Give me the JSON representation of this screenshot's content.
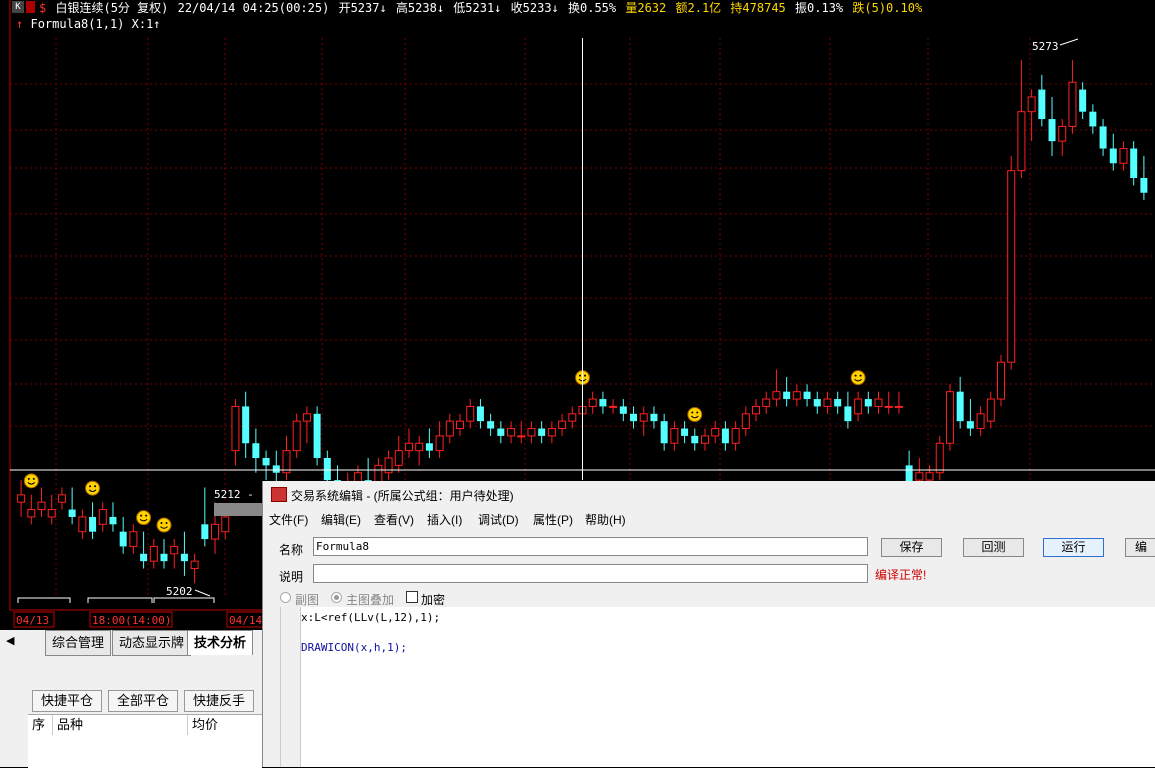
{
  "header": {
    "k_button": "K",
    "symbol_marker": "$",
    "instrument": "白银连续(5分 复权)",
    "datetime": "22/04/14 04:25(00:25)",
    "open": "开5237↓",
    "high": "高5238↓",
    "low": "低5231↓",
    "close": "收5233↓",
    "turnover": "换0.55%",
    "volume": "量2632",
    "amount": "额2.1亿",
    "hold": "持478745",
    "amplitude": "振0.13%",
    "change": "跌(5)0.10%"
  },
  "formula_line": {
    "arrow": "↑",
    "text": "Formula8(1,1) X:1↑"
  },
  "chart": {
    "price_high_label": "5273",
    "price_low_label": "5202",
    "cursor_label": "5212 -",
    "time_labels": [
      "04/13",
      "18:00(14:00)",
      "04/14"
    ],
    "colors": {
      "up": "#ff2020",
      "down": "#54ffff",
      "grid": "#7a0000",
      "axis": "#c00000",
      "smiley": "#ffd200"
    }
  },
  "chart_data": {
    "type": "candlestick",
    "series": [
      {
        "o": 5213,
        "h": 5216,
        "l": 5211,
        "c": 5214
      },
      {
        "o": 5211,
        "h": 5214,
        "l": 5210,
        "c": 5212
      },
      {
        "o": 5212,
        "h": 5215,
        "l": 5211,
        "c": 5213
      },
      {
        "o": 5211,
        "h": 5214,
        "l": 5210,
        "c": 5212
      },
      {
        "o": 5213,
        "h": 5215,
        "l": 5212,
        "c": 5214
      },
      {
        "o": 5212,
        "h": 5215,
        "l": 5210,
        "c": 5211
      },
      {
        "o": 5209,
        "h": 5212,
        "l": 5208,
        "c": 5211
      },
      {
        "o": 5211,
        "h": 5213,
        "l": 5208,
        "c": 5209
      },
      {
        "o": 5210,
        "h": 5213,
        "l": 5209,
        "c": 5212
      },
      {
        "o": 5211,
        "h": 5213,
        "l": 5209,
        "c": 5210
      },
      {
        "o": 5209,
        "h": 5211,
        "l": 5206,
        "c": 5207
      },
      {
        "o": 5207,
        "h": 5210,
        "l": 5206,
        "c": 5209
      },
      {
        "o": 5206,
        "h": 5209,
        "l": 5204,
        "c": 5205
      },
      {
        "o": 5205,
        "h": 5208,
        "l": 5204,
        "c": 5207
      },
      {
        "o": 5206,
        "h": 5208,
        "l": 5204,
        "c": 5205
      },
      {
        "o": 5206,
        "h": 5208,
        "l": 5204,
        "c": 5207
      },
      {
        "o": 5206,
        "h": 5209,
        "l": 5203,
        "c": 5205
      },
      {
        "o": 5204,
        "h": 5206,
        "l": 5202,
        "c": 5205
      },
      {
        "o": 5210,
        "h": 5215,
        "l": 5207,
        "c": 5208
      },
      {
        "o": 5208,
        "h": 5213,
        "l": 5206,
        "c": 5210
      },
      {
        "o": 5209,
        "h": 5212,
        "l": 5208,
        "c": 5211
      },
      {
        "o": 5220,
        "h": 5227,
        "l": 5218,
        "c": 5226
      },
      {
        "o": 5226,
        "h": 5228,
        "l": 5219,
        "c": 5221
      },
      {
        "o": 5221,
        "h": 5223,
        "l": 5217,
        "c": 5219
      },
      {
        "o": 5219,
        "h": 5220,
        "l": 5216,
        "c": 5218
      },
      {
        "o": 5218,
        "h": 5220,
        "l": 5214,
        "c": 5217
      },
      {
        "o": 5217,
        "h": 5222,
        "l": 5216,
        "c": 5220
      },
      {
        "o": 5220,
        "h": 5225,
        "l": 5219,
        "c": 5224
      },
      {
        "o": 5224,
        "h": 5226,
        "l": 5221,
        "c": 5225
      },
      {
        "o": 5225,
        "h": 5226,
        "l": 5218,
        "c": 5219
      },
      {
        "o": 5219,
        "h": 5220,
        "l": 5215,
        "c": 5216
      },
      {
        "o": 5216,
        "h": 5218,
        "l": 5213,
        "c": 5214
      },
      {
        "o": 5214,
        "h": 5217,
        "l": 5213,
        "c": 5215
      },
      {
        "o": 5215,
        "h": 5218,
        "l": 5214,
        "c": 5217
      },
      {
        "o": 5216,
        "h": 5219,
        "l": 5214,
        "c": 5215
      },
      {
        "o": 5215,
        "h": 5219,
        "l": 5214,
        "c": 5218
      },
      {
        "o": 5217,
        "h": 5220,
        "l": 5216,
        "c": 5219
      },
      {
        "o": 5218,
        "h": 5222,
        "l": 5217,
        "c": 5220
      },
      {
        "o": 5220,
        "h": 5223,
        "l": 5219,
        "c": 5221
      },
      {
        "o": 5220,
        "h": 5222,
        "l": 5218,
        "c": 5221
      },
      {
        "o": 5221,
        "h": 5223,
        "l": 5219,
        "c": 5220
      },
      {
        "o": 5220,
        "h": 5224,
        "l": 5219,
        "c": 5222
      },
      {
        "o": 5222,
        "h": 5225,
        "l": 5221,
        "c": 5224
      },
      {
        "o": 5223,
        "h": 5225,
        "l": 5222,
        "c": 5224
      },
      {
        "o": 5224,
        "h": 5227,
        "l": 5223,
        "c": 5226
      },
      {
        "o": 5226,
        "h": 5227,
        "l": 5223,
        "c": 5224
      },
      {
        "o": 5224,
        "h": 5225,
        "l": 5222,
        "c": 5223
      },
      {
        "o": 5223,
        "h": 5224,
        "l": 5221,
        "c": 5222
      },
      {
        "o": 5222,
        "h": 5224,
        "l": 5221,
        "c": 5223
      },
      {
        "o": 5222,
        "h": 5224,
        "l": 5221,
        "c": 5222
      },
      {
        "o": 5222,
        "h": 5224,
        "l": 5221,
        "c": 5223
      },
      {
        "o": 5223,
        "h": 5224,
        "l": 5221,
        "c": 5222
      },
      {
        "o": 5222,
        "h": 5224,
        "l": 5221,
        "c": 5223
      },
      {
        "o": 5223,
        "h": 5225,
        "l": 5222,
        "c": 5224
      },
      {
        "o": 5224,
        "h": 5226,
        "l": 5223,
        "c": 5225
      },
      {
        "o": 5225,
        "h": 5228,
        "l": 5224,
        "c": 5226
      },
      {
        "o": 5226,
        "h": 5228,
        "l": 5225,
        "c": 5227
      },
      {
        "o": 5227,
        "h": 5228,
        "l": 5225,
        "c": 5226
      },
      {
        "o": 5226,
        "h": 5227,
        "l": 5225,
        "c": 5226
      },
      {
        "o": 5226,
        "h": 5227,
        "l": 5224,
        "c": 5225
      },
      {
        "o": 5225,
        "h": 5226,
        "l": 5223,
        "c": 5224
      },
      {
        "o": 5224,
        "h": 5226,
        "l": 5222,
        "c": 5225
      },
      {
        "o": 5225,
        "h": 5226,
        "l": 5223,
        "c": 5224
      },
      {
        "o": 5224,
        "h": 5225,
        "l": 5220,
        "c": 5221
      },
      {
        "o": 5221,
        "h": 5224,
        "l": 5220,
        "c": 5223
      },
      {
        "o": 5223,
        "h": 5224,
        "l": 5221,
        "c": 5222
      },
      {
        "o": 5222,
        "h": 5223,
        "l": 5220,
        "c": 5221
      },
      {
        "o": 5221,
        "h": 5223,
        "l": 5220,
        "c": 5222
      },
      {
        "o": 5222,
        "h": 5224,
        "l": 5221,
        "c": 5223
      },
      {
        "o": 5223,
        "h": 5224,
        "l": 5220,
        "c": 5221
      },
      {
        "o": 5221,
        "h": 5224,
        "l": 5220,
        "c": 5223
      },
      {
        "o": 5223,
        "h": 5226,
        "l": 5222,
        "c": 5225
      },
      {
        "o": 5225,
        "h": 5227,
        "l": 5224,
        "c": 5226
      },
      {
        "o": 5226,
        "h": 5228,
        "l": 5225,
        "c": 5227
      },
      {
        "o": 5227,
        "h": 5231,
        "l": 5226,
        "c": 5228
      },
      {
        "o": 5228,
        "h": 5230,
        "l": 5226,
        "c": 5227
      },
      {
        "o": 5227,
        "h": 5229,
        "l": 5226,
        "c": 5228
      },
      {
        "o": 5228,
        "h": 5229,
        "l": 5226,
        "c": 5227
      },
      {
        "o": 5227,
        "h": 5228,
        "l": 5225,
        "c": 5226
      },
      {
        "o": 5226,
        "h": 5228,
        "l": 5225,
        "c": 5227
      },
      {
        "o": 5227,
        "h": 5228,
        "l": 5225,
        "c": 5226
      },
      {
        "o": 5226,
        "h": 5228,
        "l": 5223,
        "c": 5224
      },
      {
        "o": 5225,
        "h": 5228,
        "l": 5224,
        "c": 5227
      },
      {
        "o": 5227,
        "h": 5228,
        "l": 5225,
        "c": 5226
      },
      {
        "o": 5226,
        "h": 5228,
        "l": 5225,
        "c": 5227
      },
      {
        "o": 5226,
        "h": 5228,
        "l": 5225,
        "c": 5226
      },
      {
        "o": 5226,
        "h": 5228,
        "l": 5225,
        "c": 5226
      },
      {
        "o": 5218,
        "h": 5220,
        "l": 5213,
        "c": 5215
      },
      {
        "o": 5216,
        "h": 5219,
        "l": 5214,
        "c": 5217
      },
      {
        "o": 5216,
        "h": 5218,
        "l": 5215,
        "c": 5217
      },
      {
        "o": 5217,
        "h": 5222,
        "l": 5216,
        "c": 5221
      },
      {
        "o": 5221,
        "h": 5229,
        "l": 5220,
        "c": 5228
      },
      {
        "o": 5228,
        "h": 5230,
        "l": 5223,
        "c": 5224
      },
      {
        "o": 5224,
        "h": 5227,
        "l": 5222,
        "c": 5223
      },
      {
        "o": 5223,
        "h": 5226,
        "l": 5222,
        "c": 5225
      },
      {
        "o": 5224,
        "h": 5228,
        "l": 5223,
        "c": 5227
      },
      {
        "o": 5227,
        "h": 5233,
        "l": 5226,
        "c": 5232
      },
      {
        "o": 5232,
        "h": 5260,
        "l": 5231,
        "c": 5258
      },
      {
        "o": 5258,
        "h": 5273,
        "l": 5257,
        "c": 5266
      },
      {
        "o": 5266,
        "h": 5269,
        "l": 5262,
        "c": 5268
      },
      {
        "o": 5269,
        "h": 5271,
        "l": 5264,
        "c": 5265
      },
      {
        "o": 5265,
        "h": 5268,
        "l": 5260,
        "c": 5262
      },
      {
        "o": 5262,
        "h": 5265,
        "l": 5260,
        "c": 5264
      },
      {
        "o": 5264,
        "h": 5273,
        "l": 5263,
        "c": 5270
      },
      {
        "o": 5269,
        "h": 5270,
        "l": 5265,
        "c": 5266
      },
      {
        "o": 5266,
        "h": 5267,
        "l": 5263,
        "c": 5264
      },
      {
        "o": 5264,
        "h": 5265,
        "l": 5260,
        "c": 5261
      },
      {
        "o": 5261,
        "h": 5263,
        "l": 5258,
        "c": 5259
      },
      {
        "o": 5259,
        "h": 5262,
        "l": 5258,
        "c": 5261
      },
      {
        "o": 5261,
        "h": 5262,
        "l": 5256,
        "c": 5257
      },
      {
        "o": 5257,
        "h": 5260,
        "l": 5254,
        "c": 5255
      }
    ],
    "ylim": [
      5200,
      5276
    ],
    "signals": [
      1,
      7,
      12,
      14,
      55,
      66,
      82
    ],
    "cursor_index": 55
  },
  "tabs": {
    "items": [
      "综合管理",
      "动态显示牌",
      "技术分析"
    ],
    "active": 2
  },
  "trade": {
    "buttons": [
      "快捷平仓",
      "全部平仓",
      "快捷反手"
    ],
    "columns": [
      "序",
      "品种",
      "均价"
    ]
  },
  "dialog": {
    "title": "交易系统编辑 - (所属公式组：用户待处理)",
    "menu": [
      "文件(F)",
      "编辑(E)",
      "查看(V)",
      "插入(I)",
      "调试(D)",
      "属性(P)",
      "帮助(H)"
    ],
    "name_label": "名称",
    "name_value": "Formula8",
    "desc_label": "说明",
    "desc_value": "",
    "status": "编译正常!",
    "buttons": {
      "save": "保存",
      "restore": "回测",
      "run": "运行",
      "edit": "编"
    },
    "radio_sub": "副图",
    "radio_main": "主图叠加",
    "encrypt": "加密",
    "code": [
      "x:L<ref(LLv(L,12),1);",
      "",
      "DRAWICON(x,h,1);"
    ]
  }
}
